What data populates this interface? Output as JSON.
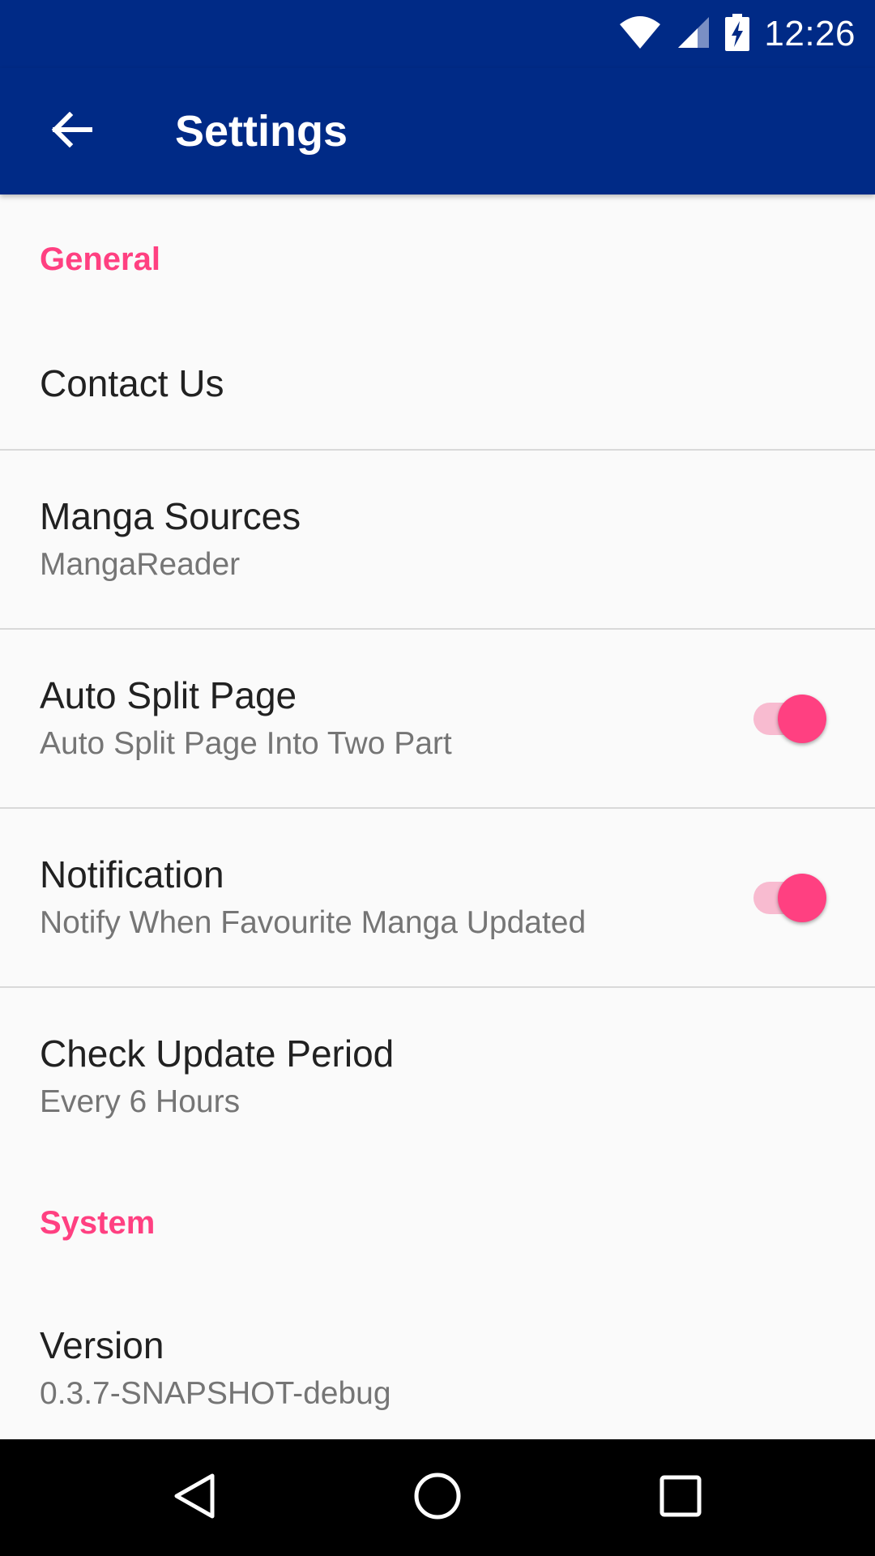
{
  "status_bar": {
    "time": "12:26",
    "icons": [
      "wifi-icon",
      "signal-icon",
      "battery-charging-icon"
    ]
  },
  "app_bar": {
    "title": "Settings",
    "back_icon": "arrow-back-icon"
  },
  "colors": {
    "primary": "#002a86",
    "accent": "#ff4081",
    "accent_light": "#f8bbd0",
    "title_text": "#212121",
    "summary_text": "#757575"
  },
  "sections": {
    "general": {
      "header": "General"
    },
    "system": {
      "header": "System"
    }
  },
  "preferences": {
    "contact": {
      "title": "Contact Us"
    },
    "sources": {
      "title": "Manga Sources",
      "summary": "MangaReader"
    },
    "auto_split": {
      "title": "Auto Split Page",
      "summary": "Auto Split Page Into Two Part",
      "enabled": true
    },
    "notification": {
      "title": "Notification",
      "summary": "Notify When Favourite Manga Updated",
      "enabled": true
    },
    "update_period": {
      "title": "Check Update Period",
      "summary": "Every 6 Hours"
    },
    "version": {
      "title": "Version",
      "summary": "0.3.7-SNAPSHOT-debug"
    }
  },
  "nav_bar": {
    "icons": [
      "back-triangle-icon",
      "home-circle-icon",
      "recents-square-icon"
    ]
  }
}
